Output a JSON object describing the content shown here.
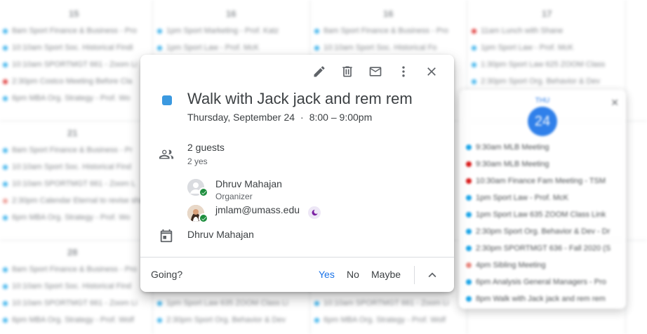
{
  "background": {
    "day_numbers": [
      "15",
      "16",
      "16",
      "17",
      "21",
      "28"
    ],
    "col1_events": [
      "8am Sport Finance & Business - Pro",
      "10:10am Sport Soc. Historical Findi",
      "10:10am SPORTMGT 661 - Zoom Li",
      "2:30pm Costco Meeting Before Cla",
      "6pm MBA Org. Strategy - Prof. Wo"
    ],
    "col2_events": [
      "1pm Sport Marketing - Prof. Katz",
      "1pm Sport Law - Prof. McK"
    ],
    "col3_events": [
      "8am Sport Finance & Business - Pro",
      "10:10am Sport Soc. Historical Fo"
    ],
    "col4_events": [
      "11am Lunch with Shane",
      "1pm Sport Law - Prof. McK",
      "1:30pm Sport Law 625 ZOOM Class",
      "2:30pm Sport Org. Behavior & Dev"
    ],
    "row2_events": [
      "8am Sport Finance & Business - Pr",
      "10:10am Sport Soc. Historical Find",
      "10:10am SPORTMGT 661 - Zoom L",
      "2:30pm Calendar Eternal to revise sha",
      "6pm MBA Org. Strategy - Prof. Wo"
    ],
    "row3_events": [
      "8am Sport Finance & Business - Pro",
      "10:10am Sport Soc. Historical Find",
      "10:10am SPORTMGT 661 - Zoom Li",
      "6pm MBA Org. Strategy - Prof. Wolf"
    ],
    "row3_col2_events": [
      "1pm Sport Law 635 ZOOM Class Li",
      "2:30pm Sport Org. Behavior & Dev"
    ],
    "row3_col3_events": [
      "10:10am SPORTMGT 661 - Zoom Li",
      "6pm MBA Org. Strategy - Prof. Wolf"
    ]
  },
  "day_popover": {
    "weekday": "THU",
    "day": "24",
    "events": [
      {
        "text": "9:30am MLB Meeting",
        "color": "#039be5"
      },
      {
        "text": "9:30am MLB Meeting",
        "color": "#d50000"
      },
      {
        "text": "10:30am Finance Fam Meeting - TSM",
        "color": "#d50000"
      },
      {
        "text": "1pm Sport Law - Prof. McK",
        "color": "#039be5"
      },
      {
        "text": "1pm Sport Law 635 ZOOM Class Link",
        "color": "#039be5"
      },
      {
        "text": "2:30pm Sport Org. Behavior & Dev - Dr",
        "color": "#039be5"
      },
      {
        "text": "2:30pm SPORTMGT 636 - Fall 2020 (S",
        "color": "#039be5"
      },
      {
        "text": "4pm Sibling Meeting",
        "color": "#e67c73"
      },
      {
        "text": "6pm Analysis General Managers - Pro",
        "color": "#039be5"
      },
      {
        "text": "8pm Walk with Jack jack and rem rem",
        "color": "#039be5"
      }
    ]
  },
  "event": {
    "color": "#3b99e0",
    "title": "Walk with Jack jack and rem rem",
    "date": "Thursday, September 24",
    "separator": "·",
    "time": "8:00 – 9:00pm",
    "guests_count": "2 guests",
    "guests_summary": "2 yes",
    "guests": [
      {
        "name": "Dhruv Mahajan",
        "role": "Organizer"
      },
      {
        "name": "jmlam@umass.edu",
        "role": ""
      }
    ],
    "calendar": "Dhruv Mahajan"
  },
  "footer": {
    "going_label": "Going?",
    "yes": "Yes",
    "no": "No",
    "maybe": "Maybe"
  }
}
